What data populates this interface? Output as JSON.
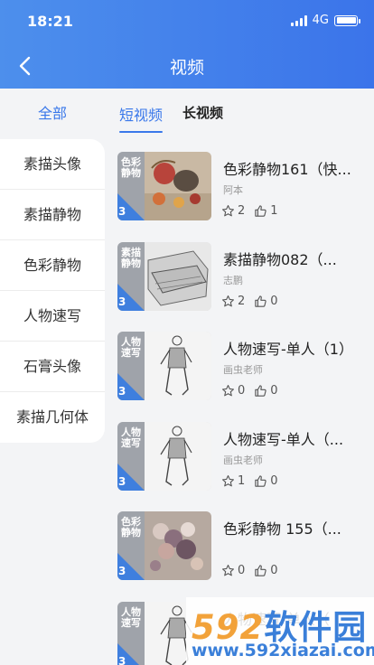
{
  "status_bar": {
    "time": "18:21",
    "network": "4G"
  },
  "header": {
    "title": "视频"
  },
  "categories": {
    "all_label": "全部",
    "items": [
      {
        "label": "素描头像"
      },
      {
        "label": "素描静物"
      },
      {
        "label": "色彩静物"
      },
      {
        "label": "人物速写"
      },
      {
        "label": "石膏头像"
      },
      {
        "label": "素描几何体"
      }
    ]
  },
  "tabs": [
    {
      "label": "短视频",
      "active": true
    },
    {
      "label": "长视频",
      "active": false
    }
  ],
  "videos": [
    {
      "title": "色彩静物161（快...",
      "author": "阿本",
      "stars": "2",
      "likes": "1",
      "thumb_label": "色彩静物",
      "thumb_badge": "3",
      "thumb_style": "color-still"
    },
    {
      "title": "素描静物082（...",
      "author": "志鹏",
      "stars": "2",
      "likes": "0",
      "thumb_label": "素描静物",
      "thumb_badge": "3",
      "thumb_style": "sketch-still"
    },
    {
      "title": "人物速写-单人（1）",
      "author": "画虫老师",
      "stars": "0",
      "likes": "0",
      "thumb_label": "人物速写",
      "thumb_badge": "3",
      "thumb_style": "figure"
    },
    {
      "title": "人物速写-单人（...",
      "author": "画虫老师",
      "stars": "1",
      "likes": "0",
      "thumb_label": "人物速写",
      "thumb_badge": "3",
      "thumb_style": "figure2"
    },
    {
      "title": "色彩静物 155（...",
      "author": "",
      "stars": "0",
      "likes": "0",
      "thumb_label": "色彩静物",
      "thumb_badge": "3",
      "thumb_style": "flowers"
    },
    {
      "title": "人物速写-单人（",
      "author": "",
      "stars": "",
      "likes": "",
      "thumb_label": "人物速写",
      "thumb_badge": "3",
      "thumb_style": "figure"
    }
  ],
  "watermark": {
    "brand_num": "592",
    "brand_text": "软件园",
    "url": "www.592xiazai.com"
  },
  "colors": {
    "accent": "#3a78ea",
    "header_start": "#4d8fec",
    "header_end": "#3b74ea"
  },
  "icons": {
    "back": "chevron-left-icon",
    "star": "star-icon",
    "like": "thumbs-up-icon"
  }
}
